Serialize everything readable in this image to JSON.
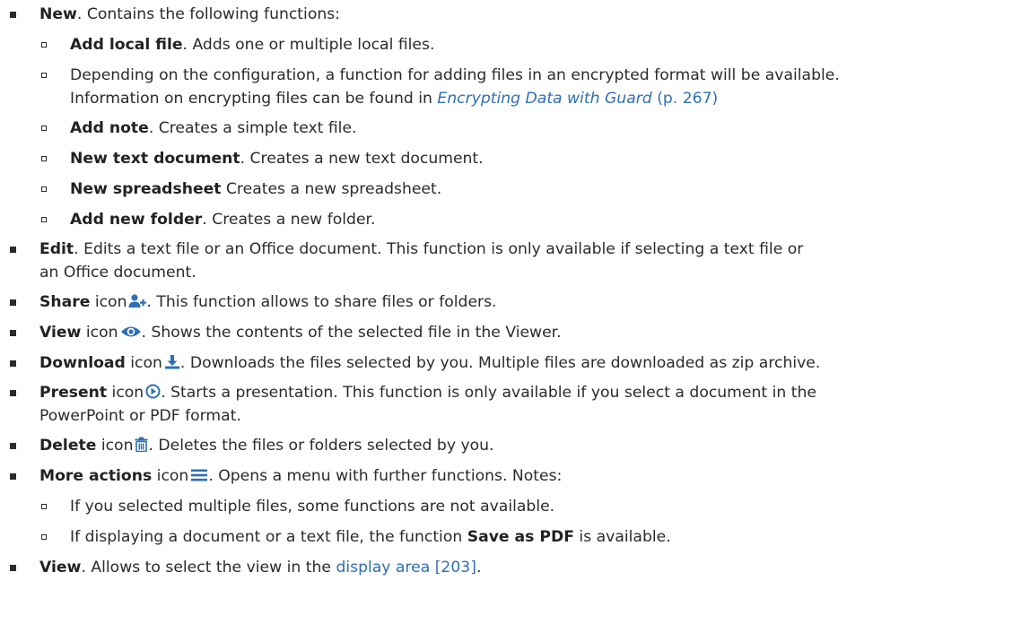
{
  "items": [
    {
      "term": "New",
      "text": ". Contains the following functions:"
    },
    {
      "term": "Add local file",
      "text": ". Adds one or multiple local files."
    },
    {
      "line1": "Depending on the configuration, a function for adding files in an encrypted format will be available.",
      "line2_prefix": "Information on encrypting files can be found in ",
      "link_text": "Encrypting Data with Guard",
      "link_page": "(p. 267)"
    },
    {
      "term": "Add note",
      "text": ". Creates a simple text file."
    },
    {
      "term": "New text document",
      "text": ". Creates a new text document."
    },
    {
      "term": "New spreadsheet",
      "text": " Creates a new spreadsheet."
    },
    {
      "term": "Add new folder",
      "text": ". Creates a new folder."
    },
    {
      "term": "Edit",
      "line1": ". Edits a text file or an Office document. This function is only available if selecting a text file or",
      "line2": "an Office document."
    },
    {
      "term": "Share",
      "icon_label": " icon",
      "icon": "share-user-plus-icon",
      "text": ". This function allows to share files or folders."
    },
    {
      "term": "View",
      "icon_label": " icon",
      "icon": "eye-icon",
      "text": ". Shows the contents of the selected file in the Viewer."
    },
    {
      "term": "Download",
      "icon_label": " icon",
      "icon": "download-icon",
      "text": ". Downloads the files selected by you. Multiple files are downloaded as zip archive."
    },
    {
      "term": "Present",
      "icon_label": " icon",
      "icon": "play-circle-icon",
      "line1": ". Starts a presentation. This function is only available if you select a document in the",
      "line2": "PowerPoint or PDF format."
    },
    {
      "term": "Delete",
      "icon_label": " icon",
      "icon": "trash-icon",
      "text": ". Deletes the files or folders selected by you."
    },
    {
      "term": "More actions",
      "icon_label": " icon",
      "icon": "menu-lines-icon",
      "text": ". Opens a menu with further functions. Notes:"
    },
    {
      "text": "If you selected multiple files, some functions are not available."
    },
    {
      "prefix": "If displaying a document or a text file, the function ",
      "term": "Save as PDF",
      "suffix": " is available."
    },
    {
      "term": "View",
      "prefix": ". Allows to select the view in the ",
      "link_text": "display area [203]",
      "suffix": "."
    }
  ],
  "colors": {
    "text": "#2b2b2b",
    "link": "#2f6fb4"
  }
}
